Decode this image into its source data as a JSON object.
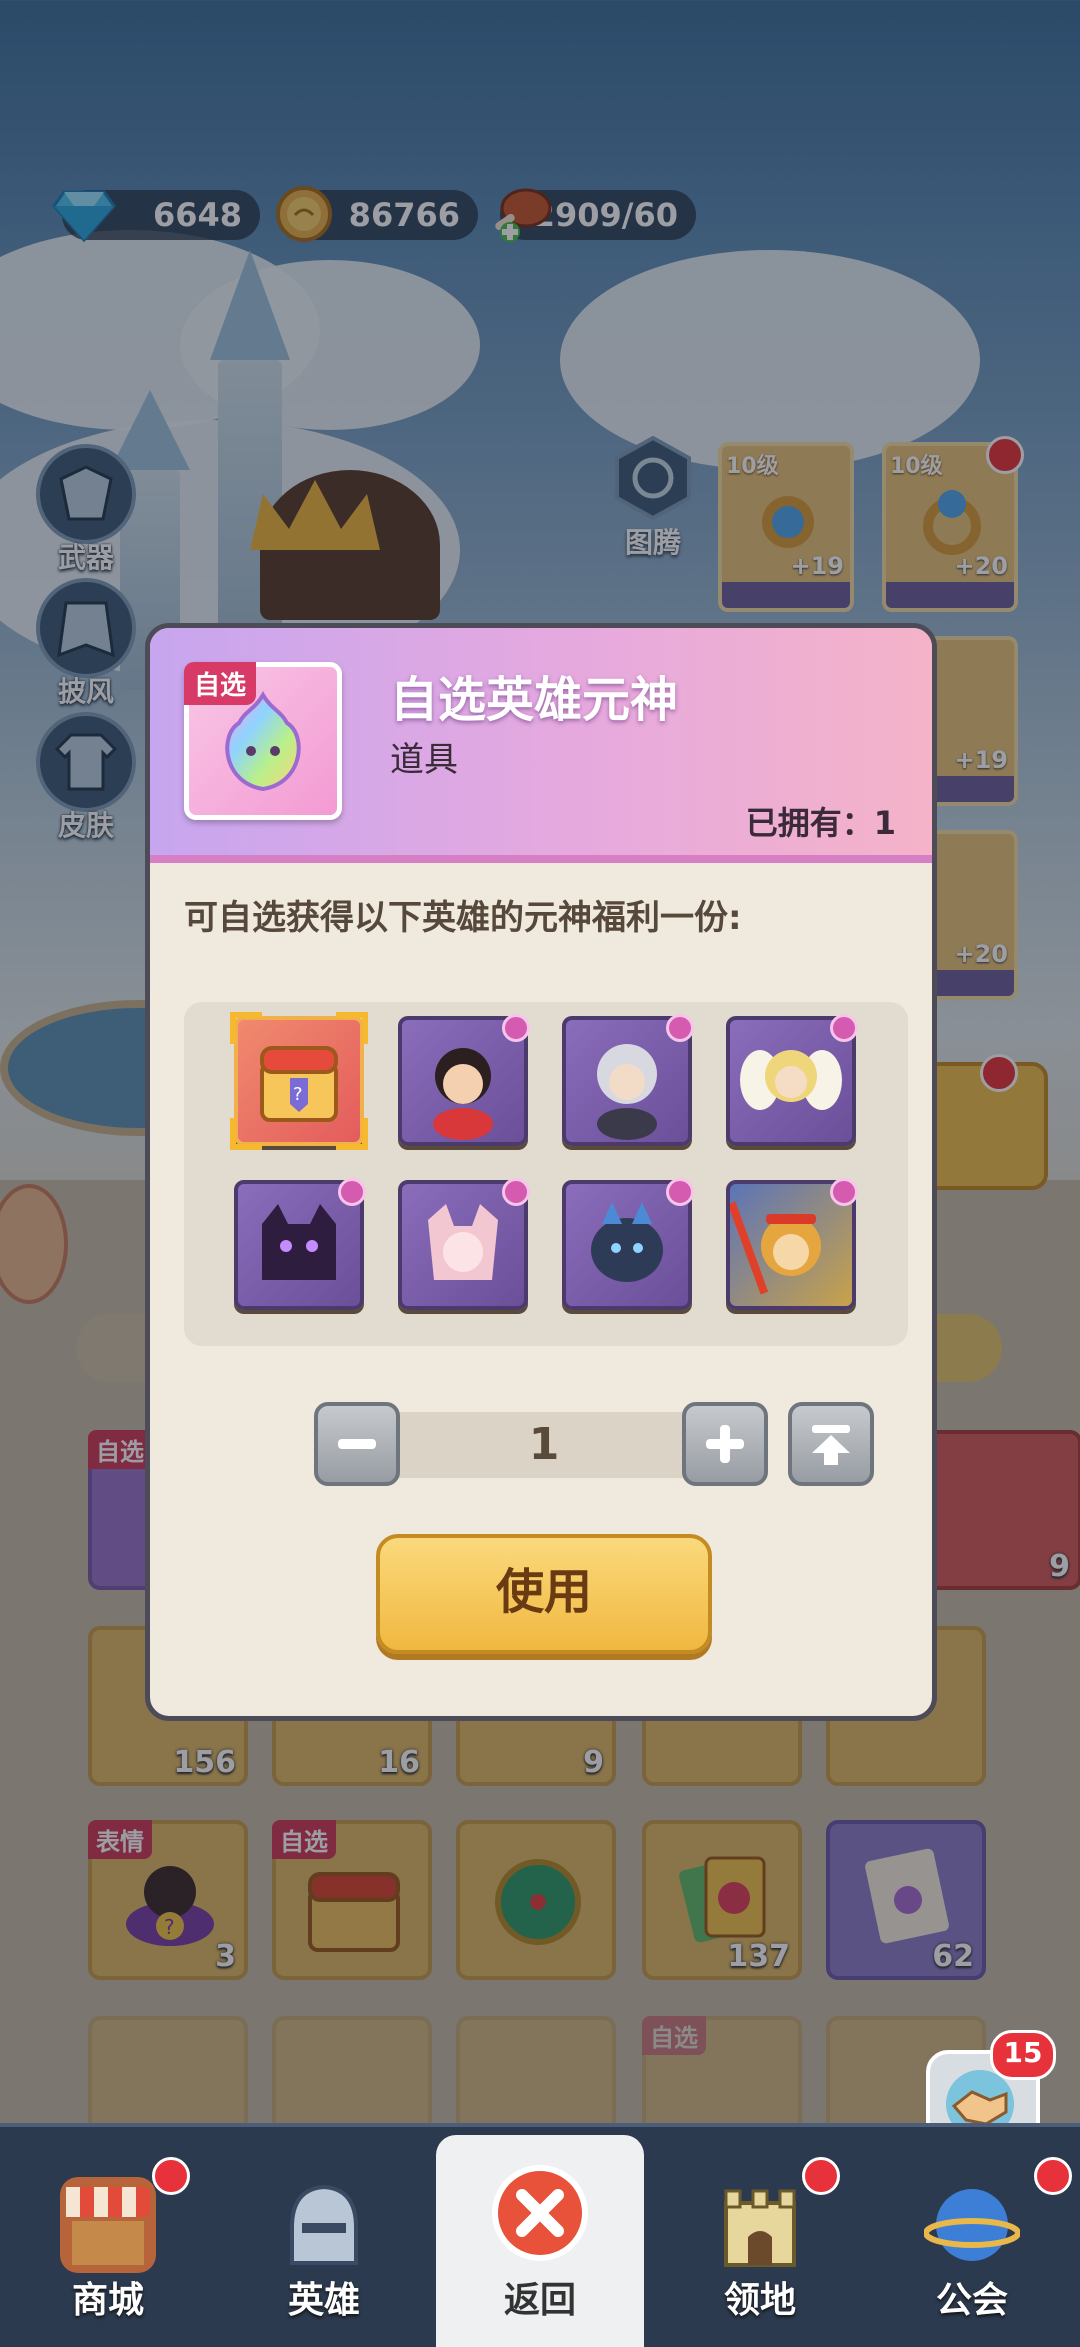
{
  "currencies": {
    "diamond": "6648",
    "gold": "86766",
    "stamina": "2909/60"
  },
  "side_menu": {
    "weapon": "武器",
    "cape": "披风",
    "skin": "皮肤"
  },
  "totem": {
    "label": "图腾"
  },
  "equipment": [
    {
      "level": "10级",
      "plus": "+19"
    },
    {
      "level": "10级",
      "plus": "+20"
    },
    {
      "plus": "+19"
    },
    {
      "plus": "+20"
    }
  ],
  "inventory": {
    "row1_counts": [
      "156",
      "16",
      "9",
      "",
      ""
    ],
    "row1_tag": "自选",
    "row1_side_count": "9",
    "row2": [
      {
        "tag": "表情",
        "count": "3"
      },
      {
        "tag": "自选",
        "count": ""
      },
      {
        "tag": "",
        "count": ""
      },
      {
        "tag": "",
        "count": "137"
      },
      {
        "tag": "",
        "count": "62"
      }
    ],
    "row3_tag": "自选"
  },
  "chat_badge": "15",
  "nav": {
    "shop": "商城",
    "heroes": "英雄",
    "back": "返回",
    "territory": "领地",
    "guild": "公会"
  },
  "modal": {
    "thumb_tag": "自选",
    "title": "自选英雄元神",
    "type": "道具",
    "owned": "已拥有：1",
    "description": "可自选获得以下英雄的元神福利一份:",
    "heroes": [
      {
        "name": "mystery-chest",
        "color": "#e45c5c"
      },
      {
        "name": "hero-red-girl",
        "color": "#8a6dbb"
      },
      {
        "name": "hero-silver-hair",
        "color": "#8a6dbb"
      },
      {
        "name": "hero-angel",
        "color": "#8a6dbb"
      },
      {
        "name": "hero-shadow-cat",
        "color": "#6b4f99"
      },
      {
        "name": "hero-pink-fox",
        "color": "#8a6dbb"
      },
      {
        "name": "hero-dark-dragon",
        "color": "#6b4f99"
      },
      {
        "name": "hero-monkey-king",
        "color": "#c9a24a"
      }
    ],
    "quantity": "1",
    "use_button": "使用"
  },
  "colors": {
    "accent_red": "#e8323b",
    "modal_bg": "#efe9de",
    "use_button": "#f0b840"
  }
}
